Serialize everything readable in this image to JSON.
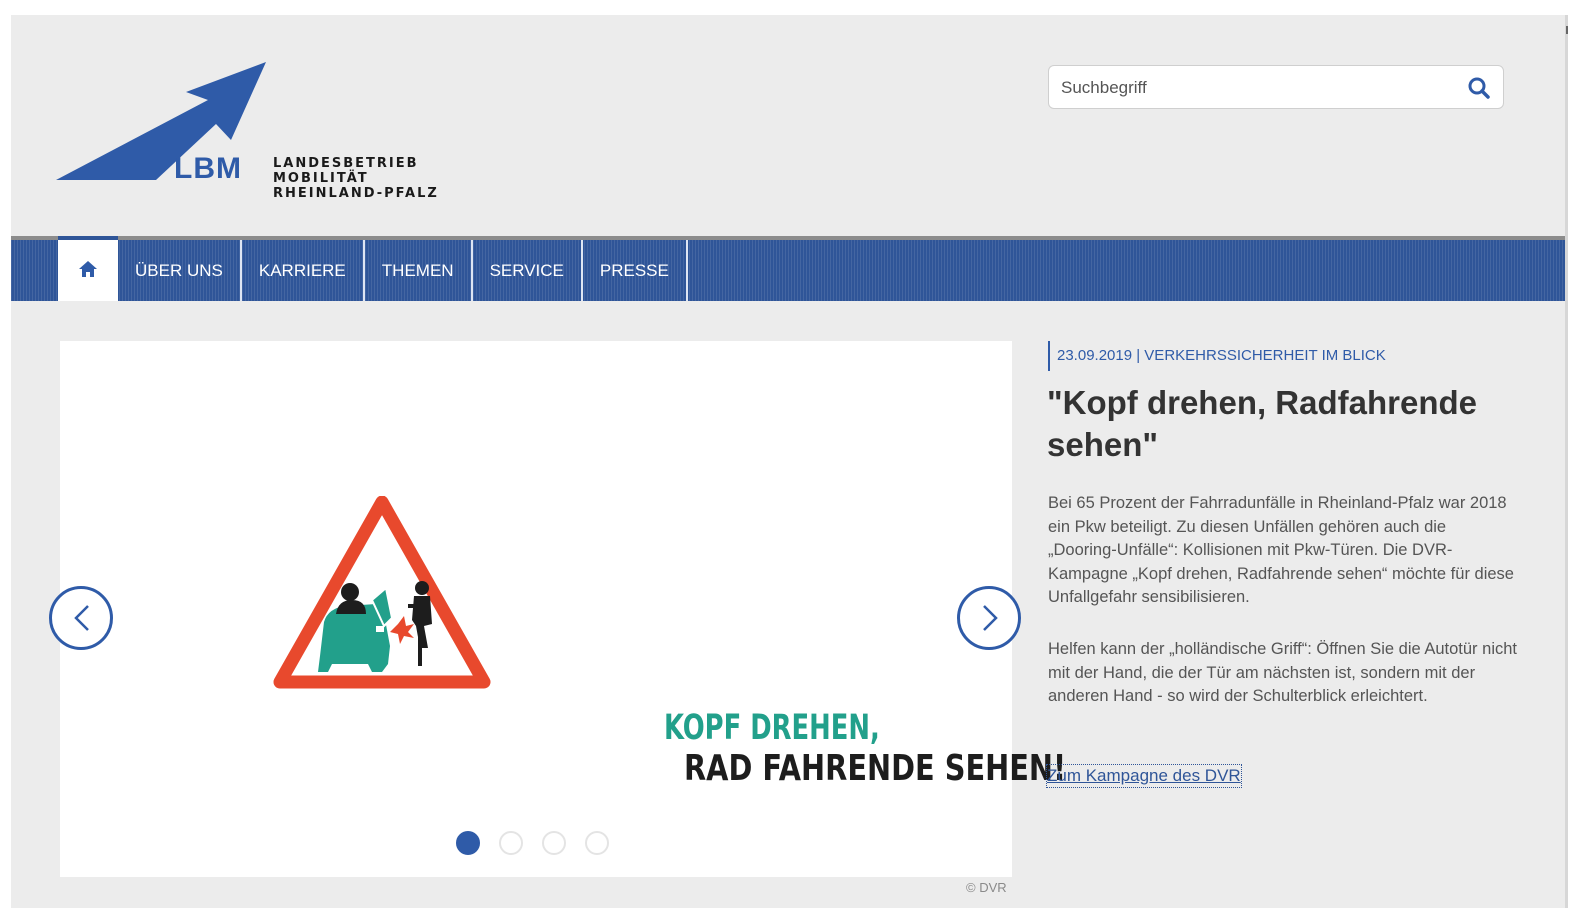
{
  "header": {
    "logo_abbr": "LBM",
    "logo_lines": [
      "LANDESBETRIEB",
      "MOBILITÄT",
      "RHEINLAND-PFALZ"
    ],
    "search_placeholder": "Suchbegriff"
  },
  "nav": {
    "home_icon": "home-icon",
    "items": [
      {
        "label": "ÜBER UNS"
      },
      {
        "label": "KARRIERE"
      },
      {
        "label": "THEMEN"
      },
      {
        "label": "SERVICE"
      },
      {
        "label": "PRESSE"
      }
    ]
  },
  "slider": {
    "slide_line_1": "KOPF DREHEN,",
    "slide_line_2": "RAD FAHRENDE SEHEN!",
    "credit": "© DVR",
    "dot_count": 4,
    "active_dot": 1
  },
  "article": {
    "meta": "23.09.2019 | VERKEHRSSICHERHEIT IM BLICK",
    "headline": "\"Kopf drehen, Radfahrende sehen\"",
    "paragraph_1": "Bei 65 Prozent der Fahrradunfälle in Rheinland-Pfalz war 2018 ein Pkw beteiligt. Zu diesen Unfällen gehören auch die „Dooring-Unfälle“: Kollisionen mit Pkw-Türen. Die DVR-Kampagne „Kopf drehen, Radfahrende sehen“ möchte für diese Unfallgefahr sensibilisieren.",
    "paragraph_2": "Helfen kann der „holländische Griff“: Öffnen Sie die Autotür nicht mit der Hand, die der Tür am nächsten ist, sondern mit der anderen Hand - so wird der Schulterblick erleichtert.",
    "link": "Zum Kampagne des DVR"
  },
  "colors": {
    "brand_blue": "#2f5ba8",
    "nav_blue": "#2f5598",
    "campaign_teal": "#22a08b",
    "warning_red": "#e8492d"
  }
}
